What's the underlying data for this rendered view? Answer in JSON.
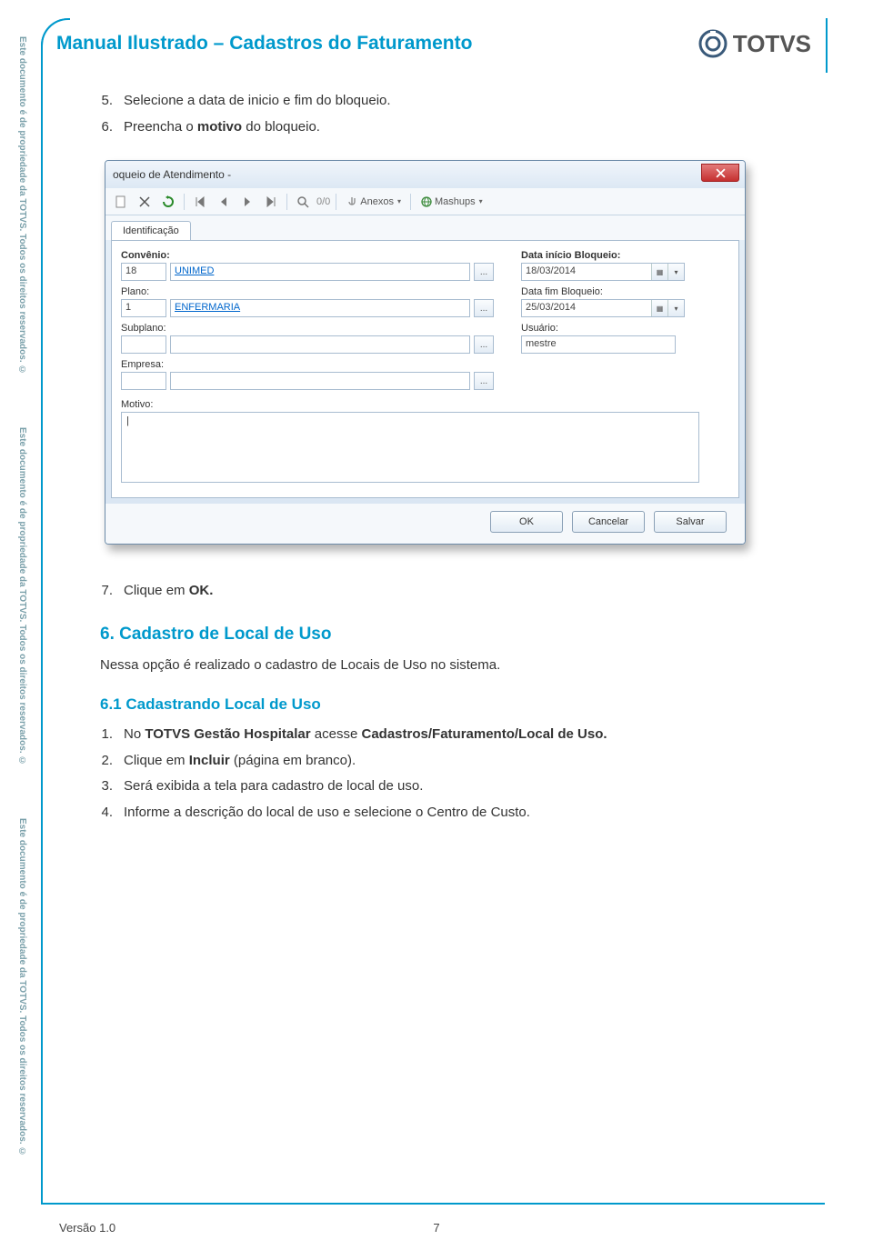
{
  "header": {
    "title": "Manual Ilustrado – Cadastros do Faturamento",
    "brand": "TOTVS"
  },
  "watermark": "Este documento é de propriedade da TOTVS. Todos os direitos reservados. ©",
  "steps_a": [
    {
      "num": "5.",
      "text": "Selecione a data de inicio e fim do bloqueio."
    },
    {
      "num": "6.",
      "text_before": "Preencha o ",
      "bold": "motivo ",
      "text_after": "do bloqueio."
    }
  ],
  "steps_b": [
    {
      "num": "7.",
      "text_before": "Clique em ",
      "bold": "OK.",
      "text_after": ""
    }
  ],
  "section6": {
    "heading": "6. Cadastro de Local de Uso",
    "text": "Nessa opção é realizado o cadastro de Locais de Uso no sistema."
  },
  "section61_heading": "6.1 Cadastrando Local de Uso",
  "steps_c": [
    {
      "num": "1.",
      "text_before": "No ",
      "bold": "TOTVS Gestão Hospitalar ",
      "text_mid": "acesse ",
      "bold2": "Cadastros/Faturamento/Local de Uso.",
      "text_after": ""
    },
    {
      "num": "2.",
      "text_before": "Clique em ",
      "bold": "Incluir ",
      "text_after": "(página em branco)."
    },
    {
      "num": "3.",
      "text": "Será exibida a tela para cadastro de local de uso."
    },
    {
      "num": "4.",
      "text": "Informe a descrição do local de uso e selecione o Centro de Custo."
    }
  ],
  "window": {
    "title": "oqueio de Atendimento -",
    "toolbar": {
      "nav_count": "0/0",
      "anexos": "Anexos",
      "mashups": "Mashups"
    },
    "tab": "Identificação",
    "labels": {
      "convenio": "Convênio:",
      "plano": "Plano:",
      "subplano": "Subplano:",
      "empresa": "Empresa:",
      "motivo": "Motivo:",
      "data_inicio": "Data início Bloqueio:",
      "data_fim": "Data fim Bloqueio:",
      "usuario": "Usuário:"
    },
    "values": {
      "convenio_code": "18",
      "convenio_name": "UNIMED",
      "plano_code": "1",
      "plano_name": "ENFERMARIA",
      "subplano_code": "",
      "subplano_name": "",
      "empresa_code": "",
      "empresa_name": "",
      "motivo": "|",
      "data_inicio": "18/03/2014",
      "data_fim": "25/03/2014",
      "usuario": "mestre"
    },
    "buttons": {
      "ok": "OK",
      "cancelar": "Cancelar",
      "salvar": "Salvar"
    }
  },
  "footer": {
    "version": "Versão 1.0",
    "page": "7"
  }
}
